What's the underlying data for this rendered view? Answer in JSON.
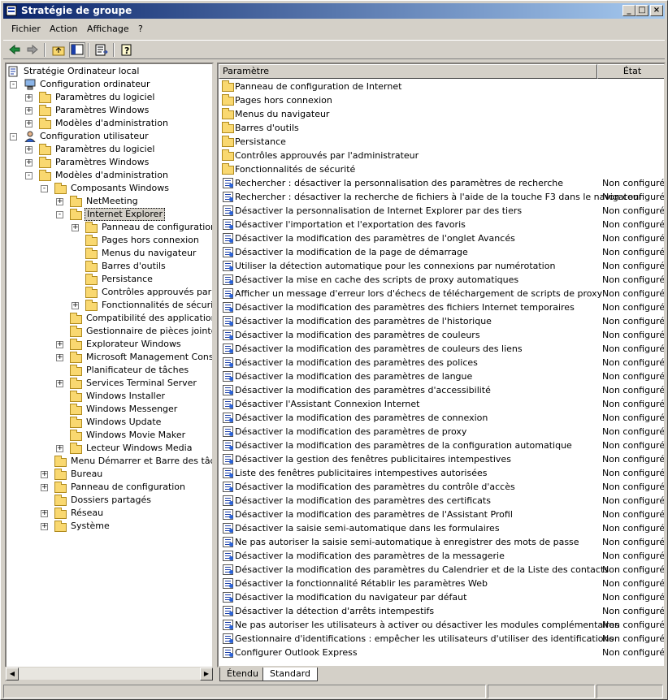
{
  "window": {
    "title": "Stratégie de groupe"
  },
  "menu": [
    "Fichier",
    "Action",
    "Affichage",
    "?"
  ],
  "tree": [
    {
      "label": "Stratégie Ordinateur local",
      "indent": 0,
      "icon": "computer-policy-icon",
      "exp": ""
    },
    {
      "label": "Configuration ordinateur",
      "indent": 1,
      "icon": "computer-icon",
      "exp": "-"
    },
    {
      "label": "Paramètres du logiciel",
      "indent": 2,
      "icon": "folder-icon",
      "exp": "+"
    },
    {
      "label": "Paramètres Windows",
      "indent": 2,
      "icon": "folder-icon",
      "exp": "+"
    },
    {
      "label": "Modèles d'administration",
      "indent": 2,
      "icon": "folder-icon",
      "exp": "+"
    },
    {
      "label": "Configuration utilisateur",
      "indent": 1,
      "icon": "user-icon",
      "exp": "-"
    },
    {
      "label": "Paramètres du logiciel",
      "indent": 2,
      "icon": "folder-icon",
      "exp": "+"
    },
    {
      "label": "Paramètres Windows",
      "indent": 2,
      "icon": "folder-icon",
      "exp": "+"
    },
    {
      "label": "Modèles d'administration",
      "indent": 2,
      "icon": "folder-icon",
      "exp": "-"
    },
    {
      "label": "Composants Windows",
      "indent": 3,
      "icon": "folder-icon",
      "exp": "-"
    },
    {
      "label": "NetMeeting",
      "indent": 4,
      "icon": "folder-icon",
      "exp": "+"
    },
    {
      "label": "Internet Explorer",
      "indent": 4,
      "icon": "folder-icon",
      "exp": "-",
      "selected": true
    },
    {
      "label": "Panneau de configuration de",
      "indent": 5,
      "icon": "folder-icon",
      "exp": "+"
    },
    {
      "label": "Pages hors connexion",
      "indent": 5,
      "icon": "folder-icon",
      "exp": ""
    },
    {
      "label": "Menus du navigateur",
      "indent": 5,
      "icon": "folder-icon",
      "exp": ""
    },
    {
      "label": "Barres d'outils",
      "indent": 5,
      "icon": "folder-icon",
      "exp": ""
    },
    {
      "label": "Persistance",
      "indent": 5,
      "icon": "folder-icon",
      "exp": ""
    },
    {
      "label": "Contrôles approuvés par l'adı",
      "indent": 5,
      "icon": "folder-icon",
      "exp": ""
    },
    {
      "label": "Fonctionnalités de sécurité",
      "indent": 5,
      "icon": "folder-icon",
      "exp": "+"
    },
    {
      "label": "Compatibilité des applications",
      "indent": 4,
      "icon": "folder-icon",
      "exp": ""
    },
    {
      "label": "Gestionnaire de pièces jointes",
      "indent": 4,
      "icon": "folder-icon",
      "exp": ""
    },
    {
      "label": "Explorateur Windows",
      "indent": 4,
      "icon": "folder-icon",
      "exp": "+"
    },
    {
      "label": "Microsoft Management Console",
      "indent": 4,
      "icon": "folder-icon",
      "exp": "+"
    },
    {
      "label": "Planificateur de tâches",
      "indent": 4,
      "icon": "folder-icon",
      "exp": ""
    },
    {
      "label": "Services Terminal Server",
      "indent": 4,
      "icon": "folder-icon",
      "exp": "+"
    },
    {
      "label": "Windows Installer",
      "indent": 4,
      "icon": "folder-icon",
      "exp": ""
    },
    {
      "label": "Windows Messenger",
      "indent": 4,
      "icon": "folder-icon",
      "exp": ""
    },
    {
      "label": "Windows Update",
      "indent": 4,
      "icon": "folder-icon",
      "exp": ""
    },
    {
      "label": "Windows Movie Maker",
      "indent": 4,
      "icon": "folder-icon",
      "exp": ""
    },
    {
      "label": "Lecteur Windows Media",
      "indent": 4,
      "icon": "folder-icon",
      "exp": "+"
    },
    {
      "label": "Menu Démarrer et Barre des tâches",
      "indent": 3,
      "icon": "folder-icon",
      "exp": ""
    },
    {
      "label": "Bureau",
      "indent": 3,
      "icon": "folder-icon",
      "exp": "+"
    },
    {
      "label": "Panneau de configuration",
      "indent": 3,
      "icon": "folder-icon",
      "exp": "+"
    },
    {
      "label": "Dossiers partagés",
      "indent": 3,
      "icon": "folder-icon",
      "exp": ""
    },
    {
      "label": "Réseau",
      "indent": 3,
      "icon": "folder-icon",
      "exp": "+"
    },
    {
      "label": "Système",
      "indent": 3,
      "icon": "folder-icon",
      "exp": "+"
    }
  ],
  "list": {
    "col_param": "Paramètre",
    "col_state": "État",
    "folders": [
      "Panneau de configuration de Internet",
      "Pages hors connexion",
      "Menus du navigateur",
      "Barres d'outils",
      "Persistance",
      "Contrôles approuvés par l'administrateur",
      "Fonctionnalités de sécurité"
    ],
    "policies": [
      "Rechercher : désactiver la personnalisation des paramètres de recherche",
      "Rechercher : désactiver la recherche de fichiers à l'aide de la touche F3 dans le navigateur",
      "Désactiver la personnalisation de Internet Explorer par des tiers",
      "Désactiver l'importation et l'exportation des favoris",
      "Désactiver la modification des paramètres de l'onglet Avancés",
      "Désactiver la modification de la page de démarrage",
      "Utiliser la détection automatique pour les connexions par numérotation",
      "Désactiver la mise en cache des scripts de proxy automatiques",
      "Afficher un message d'erreur lors d'échecs de téléchargement de scripts de proxy",
      "Désactiver la modification des paramètres des fichiers Internet temporaires",
      "Désactiver la modification des paramètres de l'historique",
      "Désactiver la modification des paramètres de couleurs",
      "Désactiver la modification des paramètres de couleurs des liens",
      "Désactiver la modification des paramètres des polices",
      "Désactiver la modification des paramètres de langue",
      "Désactiver la modification des paramètres d'accessibilité",
      "Désactiver l'Assistant Connexion Internet",
      "Désactiver la modification des paramètres de connexion",
      "Désactiver la modification des paramètres de proxy",
      "Désactiver la modification des paramètres de la configuration automatique",
      "Désactiver la gestion des fenêtres publicitaires intempestives",
      "Liste des fenêtres publicitaires intempestives autorisées",
      "Désactiver la modification des paramètres du contrôle d'accès",
      "Désactiver la modification des paramètres des certificats",
      "Désactiver la modification des paramètres de l'Assistant Profil",
      "Désactiver la saisie semi-automatique dans les formulaires",
      "Ne pas autoriser la saisie semi-automatique à enregistrer des mots de passe",
      "Désactiver la modification des paramètres de la messagerie",
      "Désactiver la modification des paramètres du Calendrier et de la Liste des contacts",
      "Désactiver la fonctionnalité Rétablir les paramètres Web",
      "Désactiver la modification du navigateur par défaut",
      "Désactiver la détection d'arrêts intempestifs",
      "Ne pas autoriser les utilisateurs à activer ou désactiver les modules complémentaires",
      "Gestionnaire d'identifications : empêcher les utilisateurs d'utiliser des identifications",
      "Configurer Outlook Express"
    ],
    "state_value": "Non configuré"
  },
  "tabs": [
    "Étendu",
    "Standard"
  ],
  "active_tab": "Standard"
}
